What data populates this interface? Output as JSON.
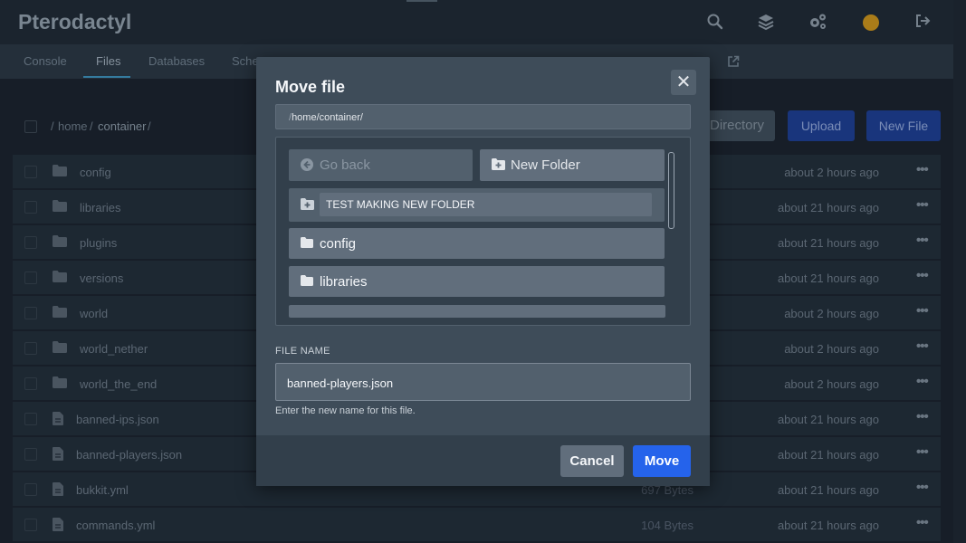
{
  "app": {
    "title": "Pterodactyl"
  },
  "topbar": {
    "icons": [
      "search-icon",
      "layers-icon",
      "cogs-icon",
      "avatar",
      "sign-out-icon"
    ]
  },
  "subnav": {
    "tabs": [
      {
        "label": "Console"
      },
      {
        "label": "Files"
      },
      {
        "label": "Databases"
      },
      {
        "label": "Sche"
      }
    ],
    "active": "Files"
  },
  "breadcrumb": {
    "parts": [
      "/",
      "home",
      "/",
      "container",
      "/"
    ]
  },
  "toolbar": {
    "directory_label": "Directory",
    "upload_label": "Upload",
    "new_file_label": "New File"
  },
  "files": [
    {
      "name": "config",
      "type": "folder",
      "size": "",
      "modified": "about 2 hours ago"
    },
    {
      "name": "libraries",
      "type": "folder",
      "size": "",
      "modified": "about 21 hours ago"
    },
    {
      "name": "plugins",
      "type": "folder",
      "size": "",
      "modified": "about 21 hours ago"
    },
    {
      "name": "versions",
      "type": "folder",
      "size": "",
      "modified": "about 21 hours ago"
    },
    {
      "name": "world",
      "type": "folder",
      "size": "",
      "modified": "about 2 hours ago"
    },
    {
      "name": "world_nether",
      "type": "folder",
      "size": "",
      "modified": "about 2 hours ago"
    },
    {
      "name": "world_the_end",
      "type": "folder",
      "size": "",
      "modified": "about 2 hours ago"
    },
    {
      "name": "banned-ips.json",
      "type": "file",
      "size": "",
      "modified": "about 21 hours ago"
    },
    {
      "name": "banned-players.json",
      "type": "file",
      "size": "",
      "modified": "about 21 hours ago"
    },
    {
      "name": "bukkit.yml",
      "type": "file",
      "size": "697 Bytes",
      "modified": "about 21 hours ago"
    },
    {
      "name": "commands.yml",
      "type": "file",
      "size": "104 Bytes",
      "modified": "about 21 hours ago"
    }
  ],
  "modal": {
    "title": "Move file",
    "path_prefix": "/",
    "path_current": "home/container/",
    "go_back_label": "Go back",
    "new_folder_label": "New Folder",
    "new_folder_value": "TEST MAKING NEW FOLDER",
    "folders": [
      "config",
      "libraries"
    ],
    "file_name_label": "FILE NAME",
    "file_name_value": "banned-players.json",
    "file_name_help": "Enter the new name for this file.",
    "cancel_label": "Cancel",
    "move_label": "Move"
  }
}
